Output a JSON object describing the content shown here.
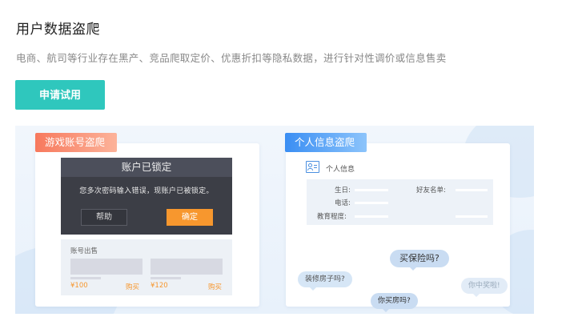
{
  "section": {
    "title": "用户数据盗爬",
    "description": "电商、航司等行业存在黑产、竞品爬取定价、优惠折扣等隐私数据，进行针对性调价或信息售卖",
    "cta_label": "申请试用"
  },
  "colors": {
    "accent": "#2fc7bd",
    "orange": "#f7972e",
    "blue": "#3a8ef3",
    "dialog_bg": "#3c3e46"
  },
  "game_card": {
    "tag": "游戏账号盗爬",
    "dialog": {
      "title": "账户已锁定",
      "message": "您多次密码输入错误，现账户已被锁定。",
      "help_label": "帮助",
      "ok_label": "确定"
    },
    "sale": {
      "title": "账号出售",
      "items": [
        {
          "price": "¥100",
          "buy_label": "购买"
        },
        {
          "price": "¥120",
          "buy_label": "购买"
        }
      ]
    }
  },
  "info_card": {
    "tag": "个人信息盗爬",
    "icon": "id-card-icon",
    "header": "个人信息",
    "fields": {
      "birthday": "生日:",
      "friends": "好友名单:",
      "phone": "电话:",
      "education": "教育程度:"
    },
    "bubbles": {
      "insurance": "买保险吗?",
      "renovation": "装修房子吗?",
      "lottery": "你中奖啦!",
      "house": "你买房吗?"
    }
  }
}
